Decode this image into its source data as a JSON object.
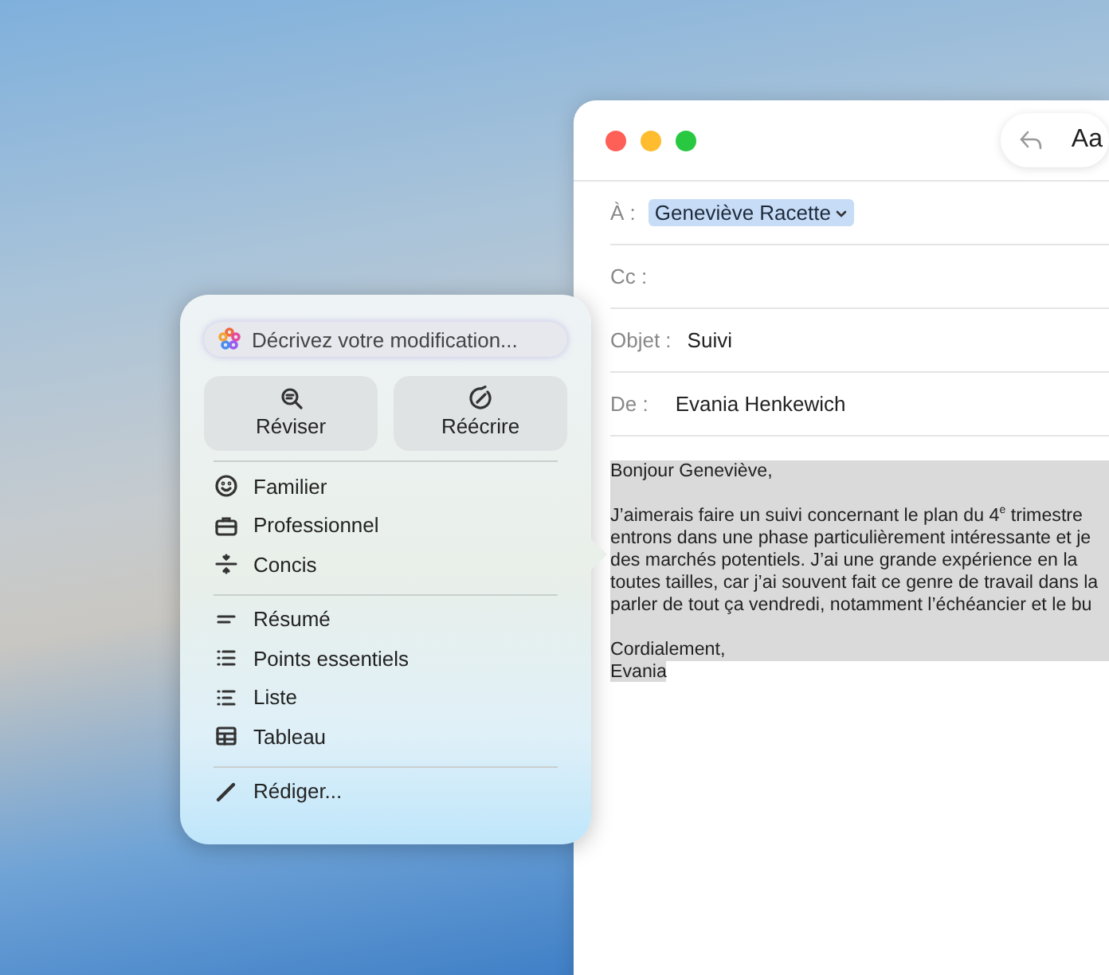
{
  "mail_window": {
    "toolbar": {
      "format_label": "Aa"
    },
    "fields": [
      {
        "label": "À :",
        "value": "Geneviève Racette",
        "kind": "token"
      },
      {
        "label": "Cc :",
        "kind": "plain"
      },
      {
        "label": "Objet :",
        "value": "Suivi",
        "kind": "plain"
      },
      {
        "label": "De :",
        "value": "Evania Henkewich",
        "kind": "plain"
      }
    ],
    "body_paragraphs": [
      [
        "Bonjour Geneviève,"
      ],
      [
        "J’aimerais faire un suivi concernant le plan du 4$^{e}$ trimestre",
        "entrons dans une phase particulièrement intéressante et je",
        "des marchés potentiels. J’ai une grande expérience en la",
        "toutes tailles, car j’ai souvent fait ce genre de travail dans la",
        "parler de tout ça vendredi, notamment l’échéancier et le bu"
      ],
      [
        "Cordialement,",
        "Evania"
      ]
    ]
  },
  "writing_tools": {
    "prompt": {
      "placeholder": "Décrivez votre modification..."
    },
    "buttons": [
      "Réviser",
      "Réécrire"
    ],
    "sections": [
      [
        "Familier",
        "Professionnel",
        "Concis"
      ],
      [
        "Résumé",
        "Points essentiels",
        "Liste",
        "Tableau"
      ],
      [
        "Rédiger..."
      ]
    ]
  }
}
